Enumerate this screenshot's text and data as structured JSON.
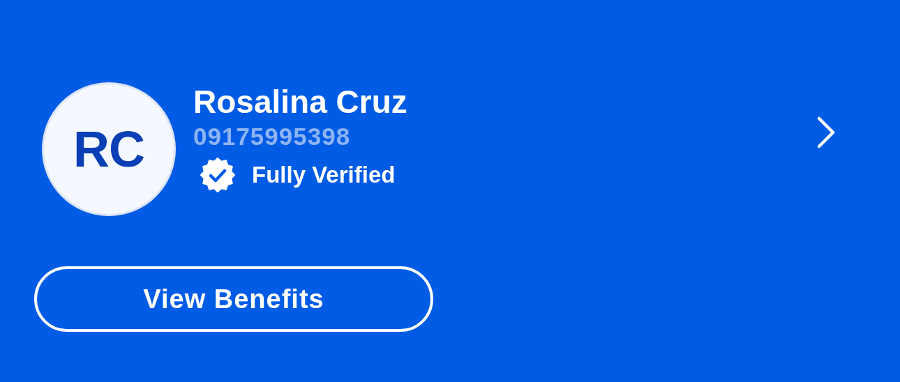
{
  "profile": {
    "initials": "RC",
    "name": "Rosalina Cruz",
    "phone": "09175995398"
  },
  "verification": {
    "verified": true,
    "label": "Fully Verified"
  },
  "button": {
    "label": "View Benefits"
  }
}
